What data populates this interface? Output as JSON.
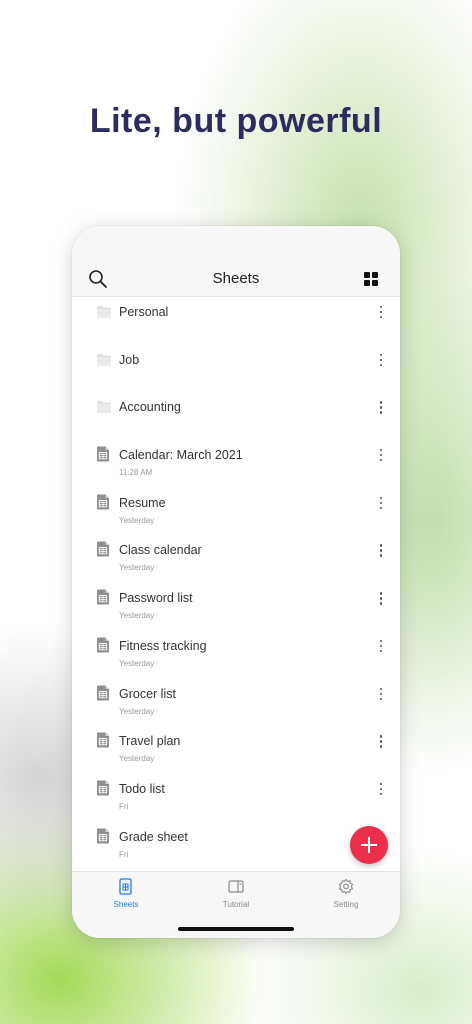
{
  "headline": "Lite, but powerful",
  "colors": {
    "accent": "#1f7ae0",
    "fab": "#ec2f4b",
    "headline": "#2c2c5e"
  },
  "navbar": {
    "title": "Sheets",
    "search_icon": "search-icon",
    "view_toggle_icon": "grid-view-icon"
  },
  "items": [
    {
      "type": "folder",
      "name": "Personal",
      "sub": ""
    },
    {
      "type": "folder",
      "name": "Job",
      "sub": ""
    },
    {
      "type": "folder",
      "name": "Accounting",
      "sub": ""
    },
    {
      "type": "sheet",
      "name": "Calendar: March 2021",
      "sub": "11:28 AM"
    },
    {
      "type": "sheet",
      "name": "Resume",
      "sub": "Yesterday"
    },
    {
      "type": "sheet",
      "name": "Class calendar",
      "sub": "Yesterday"
    },
    {
      "type": "sheet",
      "name": "Password list",
      "sub": "Yesterday"
    },
    {
      "type": "sheet",
      "name": "Fitness tracking",
      "sub": "Yesterday"
    },
    {
      "type": "sheet",
      "name": "Grocer list",
      "sub": "Yesterday"
    },
    {
      "type": "sheet",
      "name": "Travel plan",
      "sub": "Yesterday"
    },
    {
      "type": "sheet",
      "name": "Todo list",
      "sub": "Fri"
    },
    {
      "type": "sheet",
      "name": "Grade sheet",
      "sub": "Fri"
    }
  ],
  "fab": {
    "icon": "plus-icon"
  },
  "tabs": [
    {
      "label": "Sheets",
      "icon": "sheets-icon",
      "active": true
    },
    {
      "label": "Tutorial",
      "icon": "tutorial-icon",
      "active": false
    },
    {
      "label": "Setting",
      "icon": "gear-icon",
      "active": false
    }
  ]
}
